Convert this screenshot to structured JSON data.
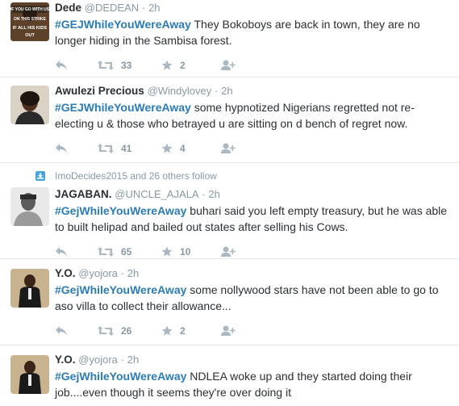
{
  "tweets": [
    {
      "name": "Dede",
      "handle": "@DEDEAN",
      "time": "2h",
      "hashtag": "#GEJWhileYouWereAway",
      "text": " They Bokoboys are back in town, they are no longer hiding in the Sambisa forest.",
      "retweets": "33",
      "favorites": "2",
      "avatar_text": "IF YOU GO WITH US ON THIS STRIKE IF ALL HIS KIDS OUT"
    },
    {
      "name": "Awulezi Precious",
      "handle": "@Windylovey",
      "time": "2h",
      "hashtag": "#GEJWhileYouWereAway",
      "text": " some hypnotized Nigerians regretted not re-electing u & those who betrayed u are sitting on d bench of regret now.",
      "retweets": "41",
      "favorites": "4"
    },
    {
      "context": "ImoDecides2015 and 26 others follow",
      "name": "JAGABAN.",
      "handle": "@UNCLE_AJALA",
      "time": "2h",
      "hashtag": "#GejWhileYouWereAway",
      "text": " buhari said you left empty treasury, but he was able to built helipad and bailed out states after selling his Cows.",
      "retweets": "65",
      "favorites": "10"
    },
    {
      "name": "Y.O.",
      "handle": "@yojora",
      "time": "2h",
      "hashtag": "#GejWhileYouWereAway",
      "text": " some nollywood stars have not been able to go to aso villa to collect their allowance...",
      "retweets": "26",
      "favorites": "2"
    },
    {
      "name": "Y.O.",
      "handle": "@yojora",
      "time": "2h",
      "hashtag": "#GejWhileYouWereAway",
      "text": " NDLEA woke up and they started doing their job....even though it seems they're over doing it"
    }
  ],
  "colors": {
    "hashtag": "#2b7bb9",
    "muted": "#8899a6",
    "icon": "#aab8c2",
    "text": "#292f33",
    "divider": "#e1e8ed"
  },
  "icons": [
    "reply-icon",
    "retweet-icon",
    "favorite-icon",
    "follow-icon",
    "follow-context-icon"
  ]
}
